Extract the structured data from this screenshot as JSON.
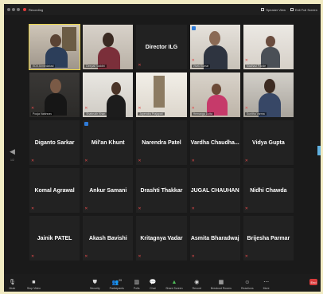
{
  "titlebar": {
    "recording_label": "Recording",
    "speaker_view_label": "Speaker View",
    "full_screen_label": "Exit Full Screen"
  },
  "video_tiles": [
    {
      "name": "EDII Ahmedabad",
      "muted": false,
      "speaking": true
    },
    {
      "name": "Deepali Vaddhi",
      "muted": false
    },
    {
      "name": "Director ILG",
      "muted": true,
      "video": false
    },
    {
      "name": "Vivek Kumar",
      "muted": true,
      "hand": true
    },
    {
      "name": "Madhavi Pande",
      "muted": true
    },
    {
      "name": "Pooja Vaishnav",
      "muted": true
    },
    {
      "name": "Shahrukh Khan",
      "muted": true
    },
    {
      "name": "Jayendra Prajapati",
      "muted": true
    },
    {
      "name": "Hemanga Dutta",
      "muted": true
    },
    {
      "name": "Sunitha Varma",
      "muted": true
    }
  ],
  "name_tiles": [
    {
      "name": "Diganto Sarkar"
    },
    {
      "name": "Mil'an Khunt",
      "hand": true
    },
    {
      "name": "Narendra Patel"
    },
    {
      "name": "Vardha Chaudha..."
    },
    {
      "name": "Vidya Gupta"
    },
    {
      "name": "Komal Agrawal"
    },
    {
      "name": "Ankur Samani"
    },
    {
      "name": "Drashti Thakkar"
    },
    {
      "name": "JUGAL CHAUHAN"
    },
    {
      "name": "Nidhi Chawda"
    },
    {
      "name": "Jainik PATEL"
    },
    {
      "name": "Akash Bavishi"
    },
    {
      "name": "Kritagnya Vadar"
    },
    {
      "name": "Asmita Bharadwaj"
    },
    {
      "name": "Brijesha Parmar"
    }
  ],
  "navigation": {
    "page_left": "1/2"
  },
  "toolbar": {
    "mute": "Mute",
    "stop_video": "Stop Video",
    "security": "Security",
    "participants": "Participants",
    "participants_count": "29",
    "polls": "Polls",
    "chat": "Chat",
    "share_screen": "Share Screen",
    "record": "Record",
    "breakout_rooms": "Breakout Rooms",
    "reactions": "Reactions",
    "more": "More",
    "end": "End"
  },
  "colors": {
    "background": "#f1ebc3",
    "tile": "#222222",
    "speaking_outline": "#e9d44a",
    "muted_icon": "#e04a4a",
    "end_button": "#d93a3a",
    "hand_raised": "#2f7bd8"
  }
}
